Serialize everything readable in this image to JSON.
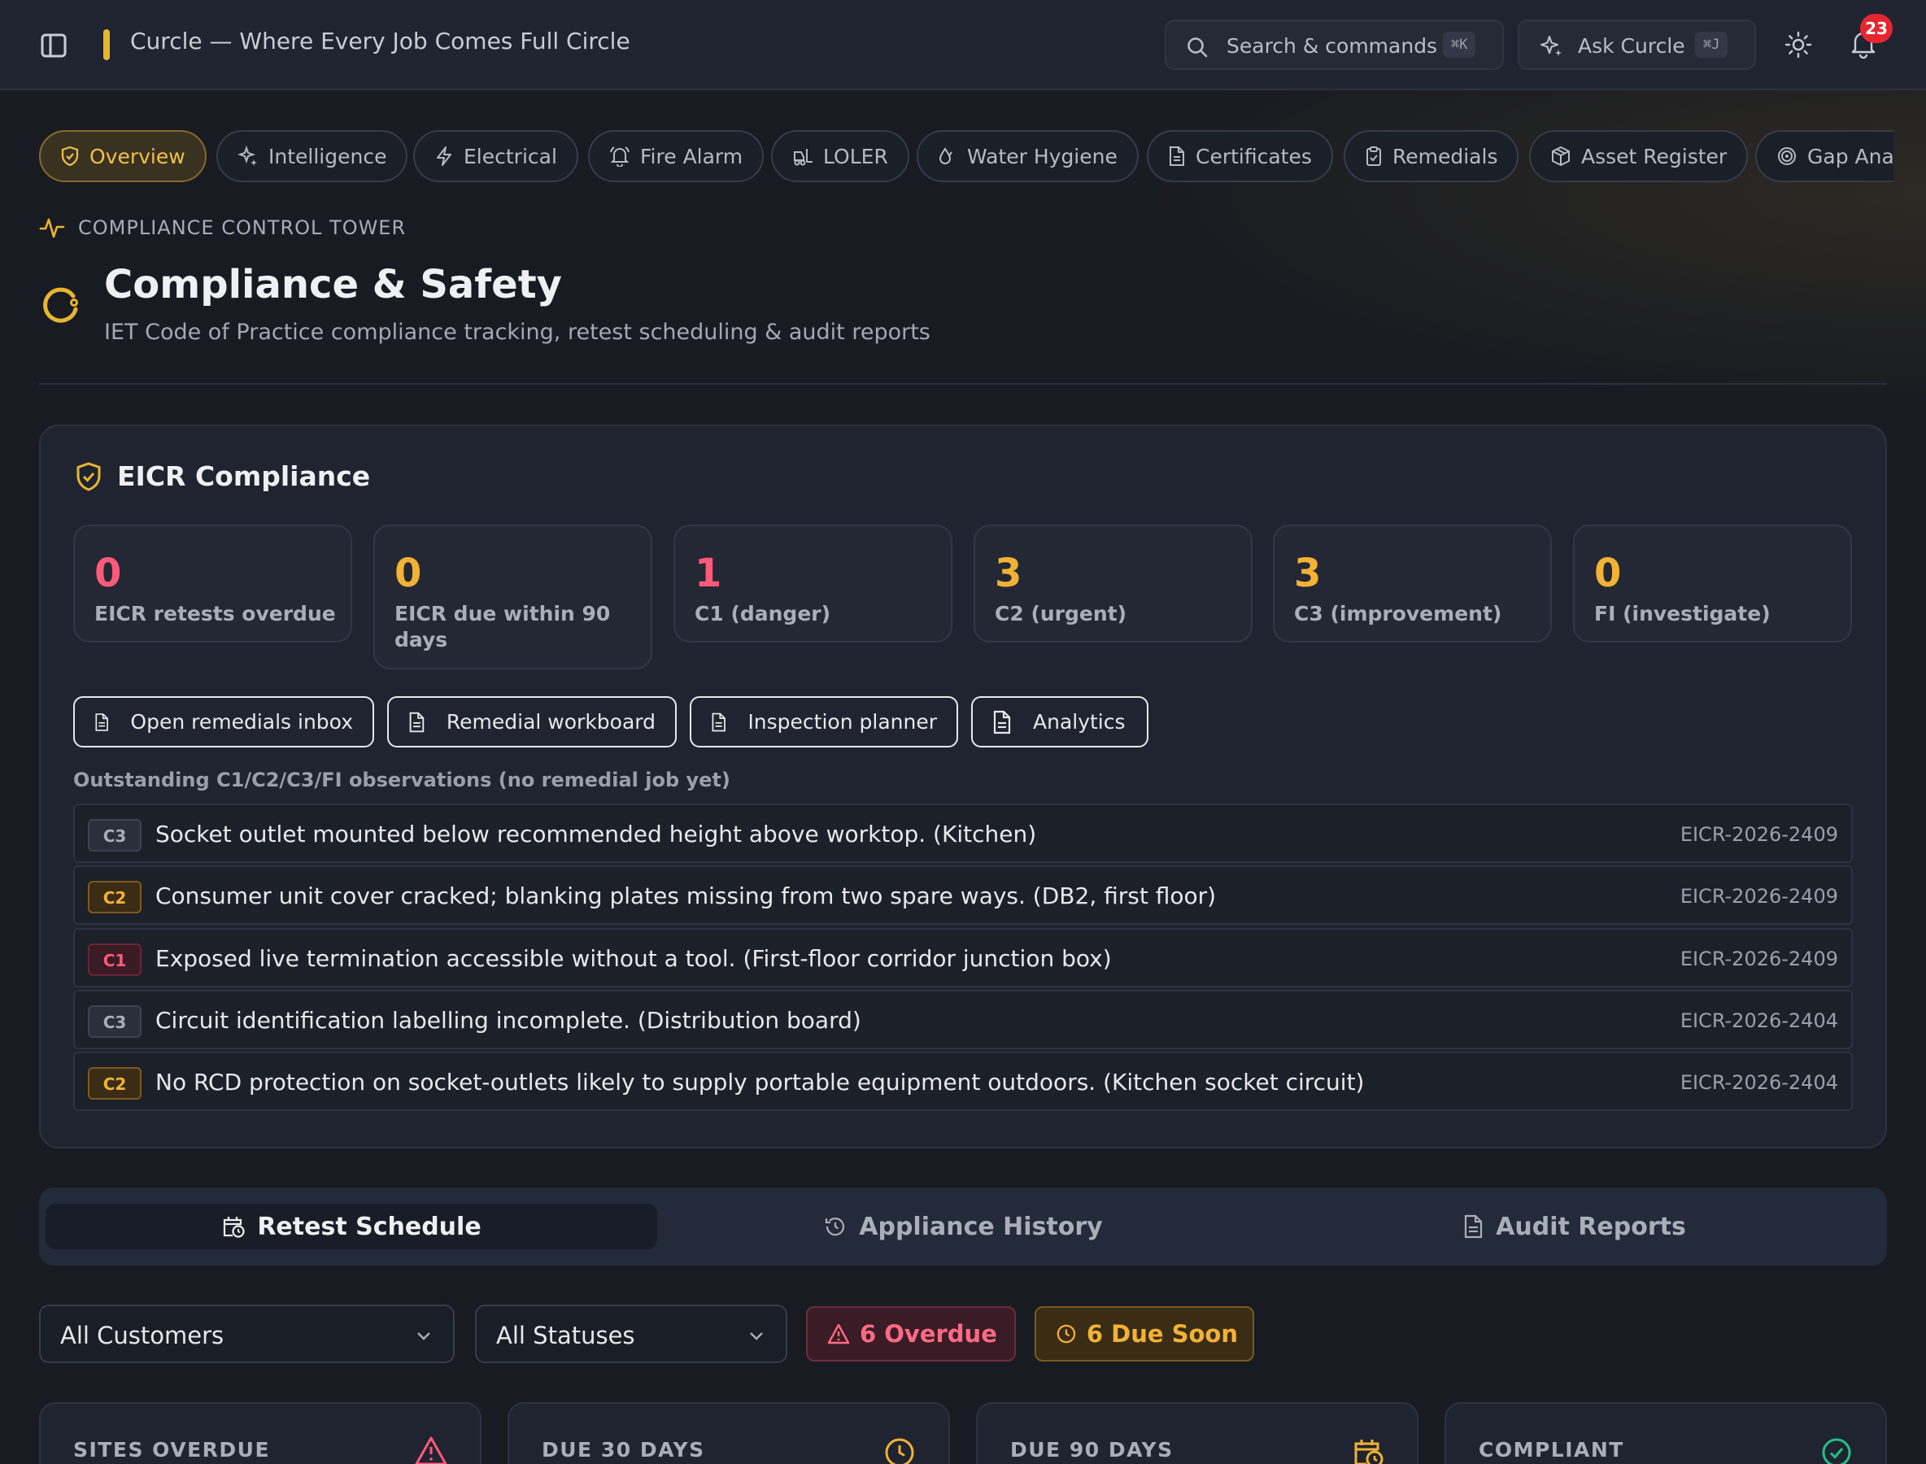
{
  "app": {
    "title": "Curcle — Where Every Job Comes Full Circle",
    "accent_color": "#e8b52f"
  },
  "topbar": {
    "search_label": "Search & commands",
    "search_shortcut": "⌘K",
    "search_icon": "search-icon",
    "ask_label": "Ask Curcle",
    "ask_shortcut": "⌘J",
    "ask_icon": "sparkles-icon",
    "theme_icon": "sun-icon",
    "notification_icon": "bell-icon",
    "notification_count": "23"
  },
  "nav": {
    "tabs": [
      {
        "label": "Overview",
        "icon": "shield-check-icon",
        "active": true
      },
      {
        "label": "Intelligence",
        "icon": "sparkles-icon"
      },
      {
        "label": "Electrical",
        "icon": "zap-icon"
      },
      {
        "label": "Fire Alarm",
        "icon": "bell-ring-icon"
      },
      {
        "label": "LOLER",
        "icon": "forklift-icon"
      },
      {
        "label": "Water Hygiene",
        "icon": "droplets-icon"
      },
      {
        "label": "Certificates",
        "icon": "file-icon"
      },
      {
        "label": "Remedials",
        "icon": "clipboard-icon"
      },
      {
        "label": "Asset Register",
        "icon": "package-icon"
      },
      {
        "label": "Gap Anal",
        "icon": "target-icon"
      }
    ]
  },
  "header": {
    "eyebrow": "COMPLIANCE CONTROL TOWER",
    "title": "Compliance & Safety",
    "subtitle": "IET Code of Practice compliance tracking, retest scheduling & audit reports"
  },
  "eicr": {
    "title": "EICR Compliance",
    "stats": [
      {
        "value": "0",
        "label": "EICR retests overdue",
        "color": "#ff5a7a"
      },
      {
        "value": "0",
        "label": "EICR due within 90 days",
        "color": "#f3b234"
      },
      {
        "value": "1",
        "label": "C1 (danger)",
        "color": "#ff5a7a"
      },
      {
        "value": "3",
        "label": "C2 (urgent)",
        "color": "#f3b234"
      },
      {
        "value": "3",
        "label": "C3 (improvement)",
        "color": "#f3b234"
      },
      {
        "value": "0",
        "label": "FI (investigate)",
        "color": "#f3b234"
      }
    ],
    "actions": [
      {
        "label": "Open remedials inbox"
      },
      {
        "label": "Remedial workboard"
      },
      {
        "label": "Inspection planner"
      },
      {
        "label": "Analytics"
      }
    ],
    "observations_heading": "Outstanding C1/C2/C3/FI observations (no remedial job yet)",
    "observations": [
      {
        "code": "C3",
        "text": "Socket outlet mounted below recommended height above worktop. (Kitchen)",
        "ref": "EICR-2026-2409"
      },
      {
        "code": "C2",
        "text": "Consumer unit cover cracked; blanking plates missing from two spare ways. (DB2, first floor)",
        "ref": "EICR-2026-2409"
      },
      {
        "code": "C1",
        "text": "Exposed live termination accessible without a tool. (First-floor corridor junction box)",
        "ref": "EICR-2026-2409"
      },
      {
        "code": "C3",
        "text": "Circuit identification labelling incomplete. (Distribution board)",
        "ref": "EICR-2026-2404"
      },
      {
        "code": "C2",
        "text": "No RCD protection on socket-outlets likely to supply portable equipment outdoors. (Kitchen socket circuit)",
        "ref": "EICR-2026-2404"
      }
    ]
  },
  "tabs": [
    {
      "label": "Retest Schedule",
      "icon": "calendar-clock-icon",
      "active": true
    },
    {
      "label": "Appliance History",
      "icon": "history-icon"
    },
    {
      "label": "Audit Reports",
      "icon": "file-text-icon"
    }
  ],
  "filters": {
    "customer": "All Customers",
    "status": "All Statuses",
    "overdue_chip": "6 Overdue",
    "due_soon_chip": "6 Due Soon"
  },
  "summary_cards": [
    {
      "label": "SITES OVERDUE",
      "icon": "alert-triangle-icon",
      "color": "#ff5a7a"
    },
    {
      "label": "DUE 30 DAYS",
      "icon": "clock-icon",
      "color": "#f3b234"
    },
    {
      "label": "DUE 90 DAYS",
      "icon": "calendar-clock-icon",
      "color": "#f3b234"
    },
    {
      "label": "COMPLIANT",
      "icon": "check-circle-icon",
      "color": "#22c08a"
    }
  ]
}
